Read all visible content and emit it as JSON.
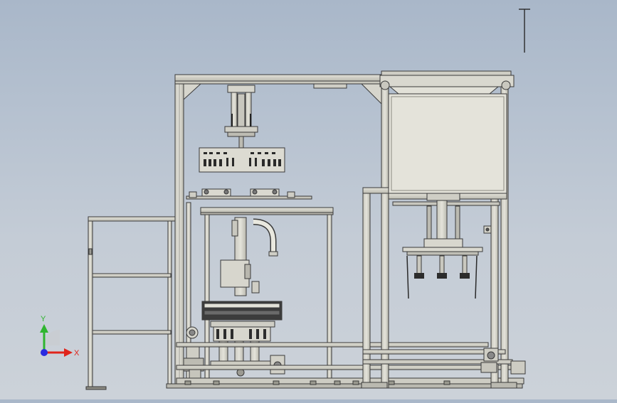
{
  "viewport": {
    "background_top": "#a9b7c9",
    "background_bottom": "#ccd2d9",
    "model_stroke": "#3a3a3a",
    "model_fill": "#d9d8cf"
  },
  "triad": {
    "x_label": "X",
    "y_label": "Y",
    "x_color": "#e0241b",
    "y_color": "#2fb52f",
    "z_color": "#2a2ae0"
  }
}
